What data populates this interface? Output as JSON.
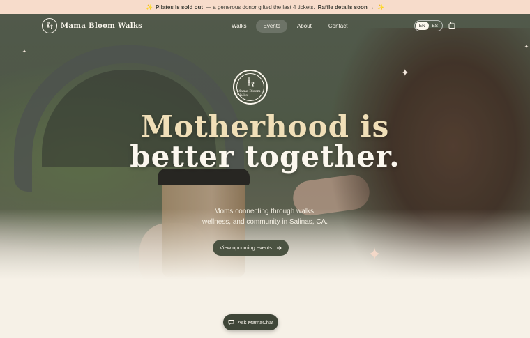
{
  "announcement": {
    "bold_lead": "Pilates is sold out",
    "middle": "— a generous donor gifted the last 4 tickets.",
    "link": "Raffle details soon →",
    "icon": "sparkles-icon"
  },
  "brand": {
    "name": "Mama Bloom Walks",
    "logo_icon": "mother-child-logo"
  },
  "nav": {
    "items": [
      {
        "label": "Walks",
        "active": false
      },
      {
        "label": "Events",
        "active": true
      },
      {
        "label": "About",
        "active": false
      },
      {
        "label": "Contact",
        "active": false
      }
    ],
    "languages": [
      {
        "code": "EN",
        "selected": true
      },
      {
        "code": "ES",
        "selected": false
      }
    ],
    "cart_icon": "shopping-bag-icon"
  },
  "hero": {
    "badge_text": "Mama Bloom Walks",
    "headline_line1": "Motherhood is",
    "headline_line2": "better together.",
    "subtitle_line1": "Moms connecting through walks,",
    "subtitle_line2": "wellness, and community in Salinas, CA.",
    "cta_label": "View upcoming events",
    "cta_icon": "arrow-right-icon"
  },
  "chat": {
    "label": "Ask MamaChat",
    "icon": "chat-bubble-icon"
  },
  "colors": {
    "announcement_bg": "#f7dccb",
    "page_bg": "#f6f1e7",
    "button_bg": "#4a5241",
    "headline_accent": "#f0dfb8"
  }
}
